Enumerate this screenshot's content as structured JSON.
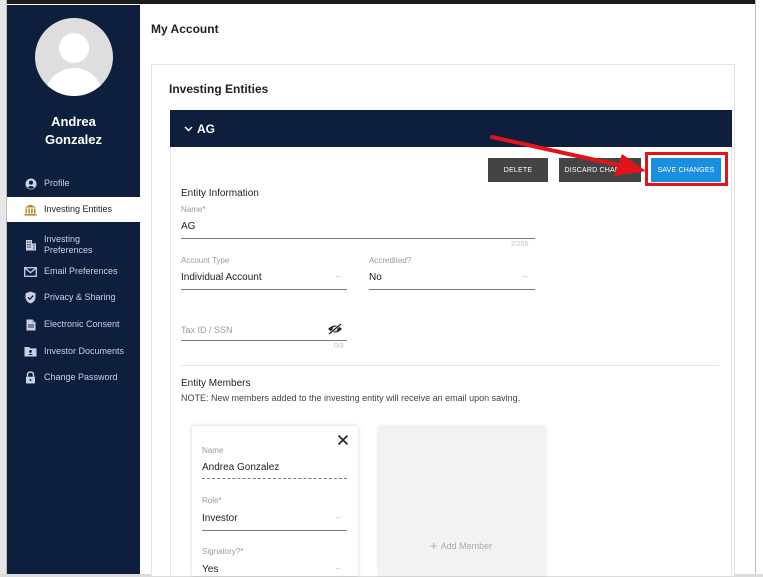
{
  "user": {
    "first_name": "Andrea",
    "last_name": "Gonzalez"
  },
  "sidebar": {
    "items": [
      {
        "label": "Profile",
        "icon": "user-circle-icon"
      },
      {
        "label": "Investing Entities",
        "icon": "bank-icon",
        "active": true
      },
      {
        "label": "Investing Preferences",
        "icon": "building-icon"
      },
      {
        "label": "Email Preferences",
        "icon": "envelope-icon"
      },
      {
        "label": "Privacy & Sharing",
        "icon": "shield-check-icon"
      },
      {
        "label": "Electronic Consent",
        "icon": "document-icon"
      },
      {
        "label": "Investor Documents",
        "icon": "folder-user-icon"
      },
      {
        "label": "Change Password",
        "icon": "lock-icon"
      }
    ]
  },
  "page": {
    "title": "My Account"
  },
  "card": {
    "title": "Investing Entities"
  },
  "entity": {
    "name": "AG",
    "actions": {
      "delete": "DELETE",
      "discard": "DISCARD CHANGES",
      "save": "SAVE CHANGES"
    },
    "info_heading": "Entity Information",
    "name_field": {
      "label": "Name",
      "value": "AG",
      "counter": "2/255"
    },
    "account_type": {
      "label": "Account Type",
      "value": "Individual Account"
    },
    "accredited": {
      "label": "Accredited?",
      "value": "No"
    },
    "tax_id": {
      "placeholder": "Tax ID / SSN",
      "counter": "0/9"
    },
    "members_heading": "Entity Members",
    "members_note": "NOTE: New members added to the investing entity will receive an email upon saving.",
    "member": {
      "name_label": "Name",
      "name_value": "Andrea Gonzalez",
      "role_label": "Role",
      "role_value": "Investor",
      "signatory_label": "Signatory?",
      "signatory_value": "Yes"
    },
    "add_member_label": "Add Member"
  },
  "colors": {
    "sidebar": "#0d1f3c",
    "save_button": "#1a8fe0",
    "highlight": "#e3131b"
  }
}
